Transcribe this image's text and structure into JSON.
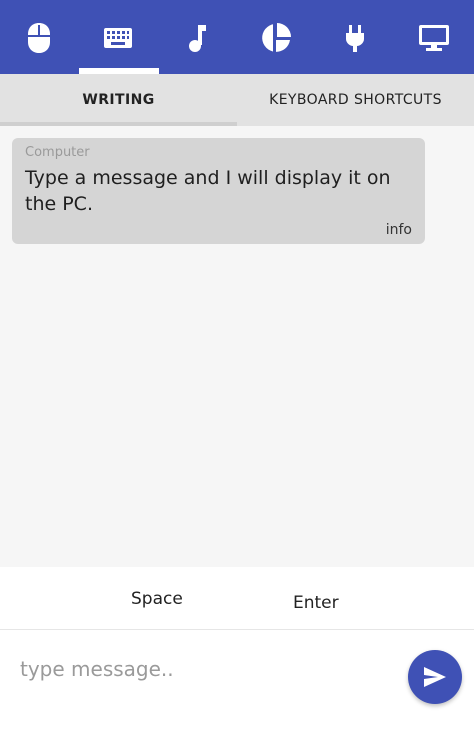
{
  "topbar": {
    "icons": [
      "mouse-icon",
      "keyboard-icon",
      "music-note-icon",
      "pie-chart-icon",
      "power-plug-icon",
      "monitor-icon"
    ],
    "selected": "keyboard-icon",
    "color": "#3f51b5"
  },
  "subtabs": {
    "writing": "WRITING",
    "shortcuts": "KEYBOARD SHORTCUTS",
    "active": "WRITING"
  },
  "message": {
    "sender": "Computer",
    "text": "Type a message and I will display it on the PC.",
    "tag": "info"
  },
  "keys": {
    "space": "Space",
    "enter": "Enter"
  },
  "input": {
    "placeholder": "type message.."
  },
  "send": {
    "icon": "send-icon"
  }
}
